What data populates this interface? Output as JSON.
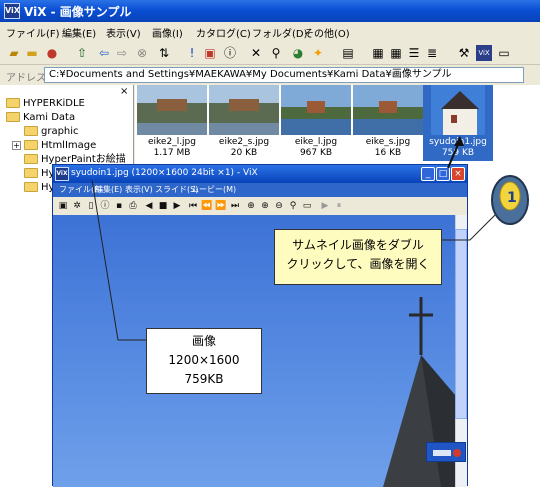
{
  "main_window": {
    "title": "ViX - 画像サンプル",
    "app_icon_text": "ViX",
    "menu": [
      "ファイル(F)",
      "編集(E)",
      "表示(V)",
      "画像(I)",
      "カタログ(C)",
      "フォルダ(D)",
      "その他(O)"
    ],
    "address_label": "アドレス",
    "address_value": "C:¥Documents and Settings¥MAEKAWA¥My Documents¥Kami Data¥画像サンプル"
  },
  "folder_tree": {
    "close_glyph": "×",
    "items": [
      {
        "label": "HYPERKiDLE",
        "expander": ""
      },
      {
        "label": "Kami Data",
        "expander": ""
      },
      {
        "label": "graphic",
        "expander": ""
      },
      {
        "label": "HtmlImage",
        "expander": "+"
      },
      {
        "label": "HyperPaintお絵描",
        "expander": ""
      },
      {
        "label": "Hy",
        "expander": ""
      },
      {
        "label": "Hy",
        "expander": ""
      }
    ]
  },
  "thumbnails": [
    {
      "name": "eike2_l.jpg",
      "size": "1.17 MB",
      "selected": false
    },
    {
      "name": "eike2_s.jpg",
      "size": "20 KB",
      "selected": false
    },
    {
      "name": "eike_l.jpg",
      "size": "967 KB",
      "selected": false
    },
    {
      "name": "eike_s.jpg",
      "size": "16 KB",
      "selected": false
    },
    {
      "name": "syudoin1.jpg",
      "size": "759 KB",
      "selected": true
    }
  ],
  "viewer": {
    "title": "syudoin1.jpg (1200×1600 24bit ×1) - ViX",
    "menu": [
      "ファイル(F)",
      "編集(E)",
      "表示(V)",
      "スライド(S)",
      "ムービー(M)"
    ],
    "buttons": {
      "minimize": "_",
      "maximize": "□",
      "close": "×"
    }
  },
  "callouts": {
    "instruction_line1": "サムネイル画像をダブル",
    "instruction_line2": "クリックして、画像を開く",
    "info_line1": "画像",
    "info_line2": "1200×1600",
    "info_line3": "759KB"
  },
  "mouse_badge": "1"
}
